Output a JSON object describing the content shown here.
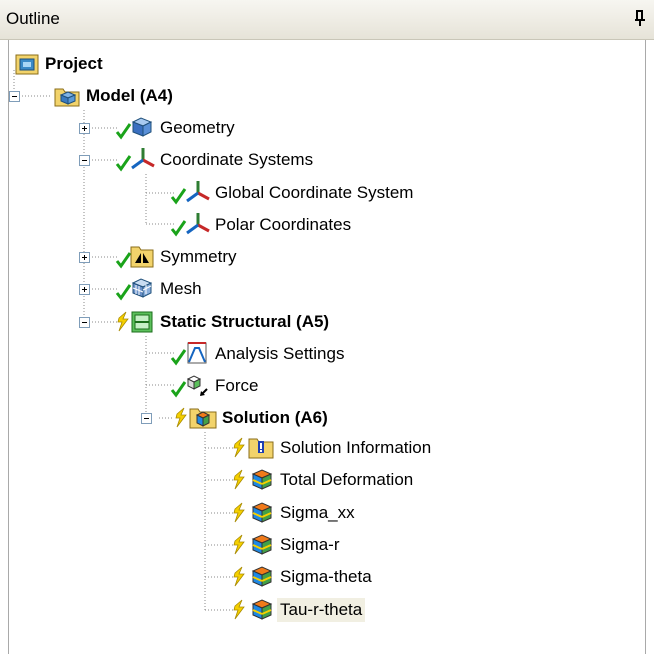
{
  "panel": {
    "title": "Outline"
  },
  "tree": {
    "project": "Project",
    "model": "Model (A4)",
    "geometry": "Geometry",
    "coordinate_systems": "Coordinate Systems",
    "global_cs": "Global Coordinate System",
    "polar_cs": "Polar Coordinates",
    "symmetry": "Symmetry",
    "mesh": "Mesh",
    "static_structural": "Static Structural (A5)",
    "analysis_settings": "Analysis Settings",
    "force": "Force",
    "solution": "Solution (A6)",
    "solution_information": "Solution Information",
    "total_deformation": "Total Deformation",
    "sigma_xx": "Sigma_xx",
    "sigma_r": "Sigma-r",
    "sigma_theta": "Sigma-theta",
    "tau_r_theta": "Tau-r-theta"
  },
  "colors": {
    "check": "#1aa31a",
    "lightning": "#e8c000",
    "selection": "#f1efe2",
    "folder": "#f2d36b"
  }
}
